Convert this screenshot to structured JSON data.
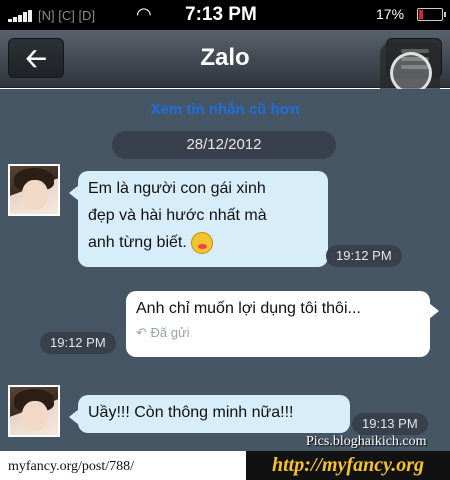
{
  "status_bar": {
    "carrier": "[N] [C] [D]",
    "time": "7:13 PM",
    "battery": "17%",
    "battery_level": 0.17,
    "icons": [
      "signal-icon",
      "wifi-icon",
      "battery-icon"
    ]
  },
  "nav": {
    "title": "Zalo",
    "back_icon": "🡠",
    "icons": [
      "back-arrow-icon",
      "menu-icon",
      "assistive-touch-icon"
    ]
  },
  "chat": {
    "older_messages_link": "Xem tin nhắn cũ hơn",
    "date": "28/12/2012",
    "messages": [
      {
        "direction": "incoming",
        "lines": [
          "Em là người con gái xinh",
          "đẹp và hài hước nhất mà",
          "anh từng biết."
        ],
        "emoji": "blushing-face-icon",
        "time": "19:12 PM"
      },
      {
        "direction": "outgoing",
        "lines": [
          "Anh chỉ muốn lợi dụng tôi thôi..."
        ],
        "status": "↶ Đã gửi",
        "time": "19:12 PM"
      },
      {
        "direction": "incoming",
        "lines": [
          "Uầy!!! Còn thông minh nữa!!!"
        ],
        "time": "19:13 PM"
      }
    ]
  },
  "footer": {
    "url": "myfancy.org/post/788/",
    "brand": "http://myfancy.org",
    "watermark": "Pics.bloghaikich.com"
  }
}
